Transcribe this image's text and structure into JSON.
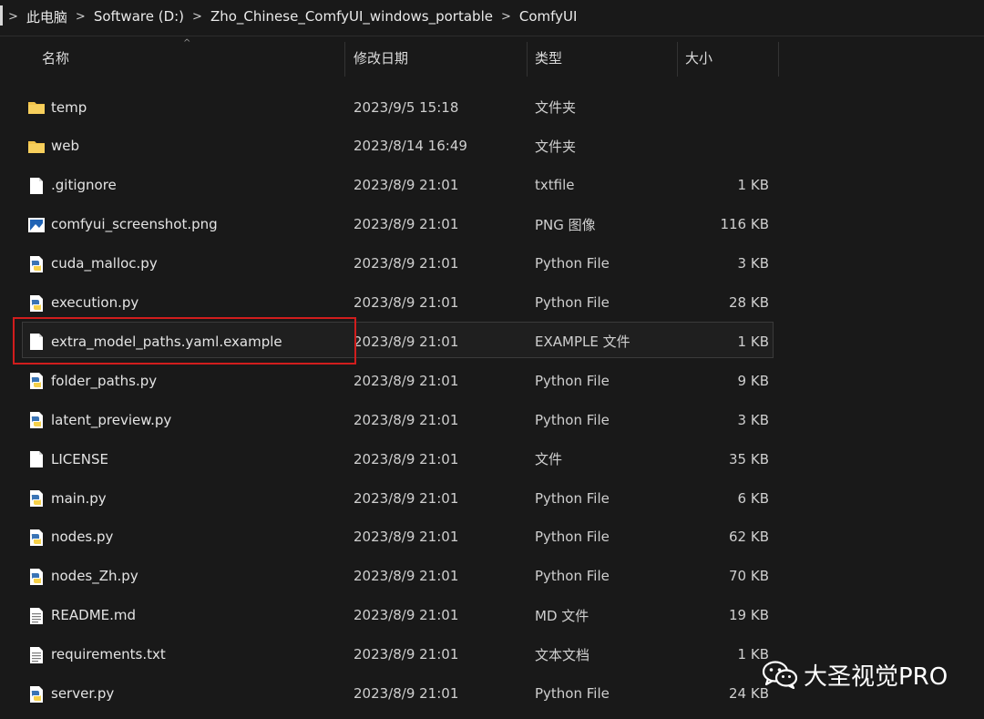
{
  "breadcrumb": {
    "items": [
      "此电脑",
      "Software (D:)",
      "Zho_Chinese_ComfyUI_windows_portable",
      "ComfyUI"
    ]
  },
  "columns": {
    "name": "名称",
    "date": "修改日期",
    "type": "类型",
    "size": "大小"
  },
  "files": [
    {
      "name": "temp",
      "date": "2023/9/5 15:18",
      "type": "文件夹",
      "size": "",
      "icon": "folder-icon"
    },
    {
      "name": "web",
      "date": "2023/8/14 16:49",
      "type": "文件夹",
      "size": "",
      "icon": "folder-icon"
    },
    {
      "name": ".gitignore",
      "date": "2023/8/9 21:01",
      "type": "txtfile",
      "size": "1 KB",
      "icon": "file-icon"
    },
    {
      "name": "comfyui_screenshot.png",
      "date": "2023/8/9 21:01",
      "type": "PNG 图像",
      "size": "116 KB",
      "icon": "image-icon"
    },
    {
      "name": "cuda_malloc.py",
      "date": "2023/8/9 21:01",
      "type": "Python File",
      "size": "3 KB",
      "icon": "python-file-icon"
    },
    {
      "name": "execution.py",
      "date": "2023/8/9 21:01",
      "type": "Python File",
      "size": "28 KB",
      "icon": "python-file-icon"
    },
    {
      "name": "extra_model_paths.yaml.example",
      "date": "2023/8/9 21:01",
      "type": "EXAMPLE 文件",
      "size": "1 KB",
      "icon": "file-icon"
    },
    {
      "name": "folder_paths.py",
      "date": "2023/8/9 21:01",
      "type": "Python File",
      "size": "9 KB",
      "icon": "python-file-icon"
    },
    {
      "name": "latent_preview.py",
      "date": "2023/8/9 21:01",
      "type": "Python File",
      "size": "3 KB",
      "icon": "python-file-icon"
    },
    {
      "name": "LICENSE",
      "date": "2023/8/9 21:01",
      "type": "文件",
      "size": "35 KB",
      "icon": "file-icon"
    },
    {
      "name": "main.py",
      "date": "2023/8/9 21:01",
      "type": "Python File",
      "size": "6 KB",
      "icon": "python-file-icon"
    },
    {
      "name": "nodes.py",
      "date": "2023/8/9 21:01",
      "type": "Python File",
      "size": "62 KB",
      "icon": "python-file-icon"
    },
    {
      "name": "nodes_Zh.py",
      "date": "2023/8/9 21:01",
      "type": "Python File",
      "size": "70 KB",
      "icon": "python-file-icon"
    },
    {
      "name": "README.md",
      "date": "2023/8/9 21:01",
      "type": "MD 文件",
      "size": "19 KB",
      "icon": "text-file-icon"
    },
    {
      "name": "requirements.txt",
      "date": "2023/8/9 21:01",
      "type": "文本文档",
      "size": "1 KB",
      "icon": "text-file-icon"
    },
    {
      "name": "server.py",
      "date": "2023/8/9 21:01",
      "type": "Python File",
      "size": "24 KB",
      "icon": "python-file-icon"
    }
  ],
  "watermark": {
    "text": "大圣视觉PRO",
    "icon": "wechat-icon"
  },
  "colors": {
    "background": "#191919",
    "folder": "#f2c34a",
    "highlight_border": "#d11d1d",
    "python_blue": "#3a74b5",
    "python_yellow": "#f6d14a"
  }
}
